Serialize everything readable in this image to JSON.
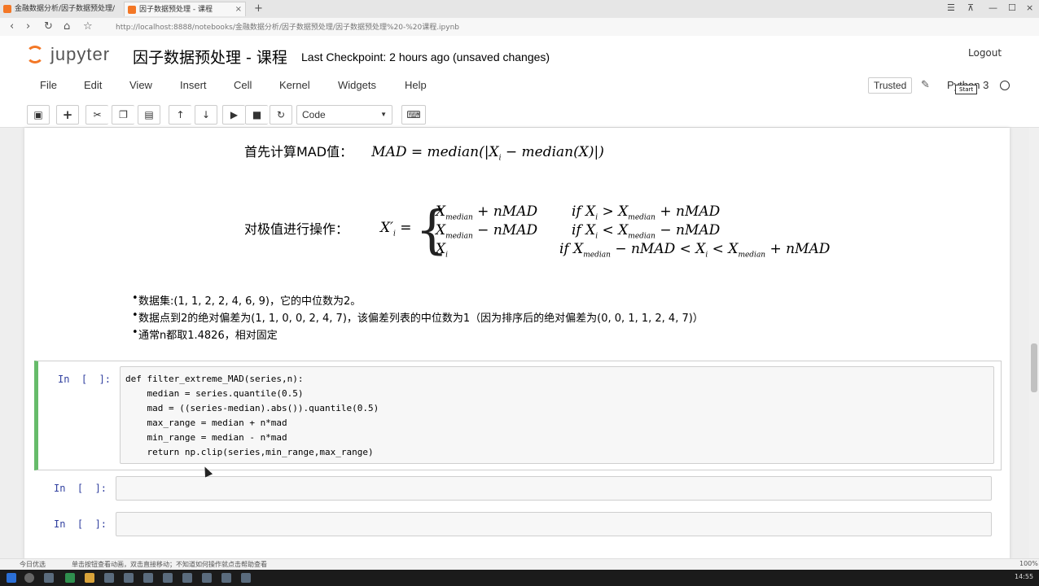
{
  "browser": {
    "tabs": [
      {
        "label": "金融数据分析/因子数据预处理/"
      },
      {
        "label": "因子数据预处理 - 课程"
      }
    ],
    "new_tab": "+",
    "url": "http://localhost:8888/notebooks/金融数据分析/因子数据预处理/因子数据预处理%20-%20课程.ipynb"
  },
  "jupyter": {
    "logo_text": "jupyter",
    "notebook_title": "因子数据预处理 - 课程",
    "checkpoint": "Last Checkpoint: 2 hours ago (unsaved changes)",
    "logout": "Logout"
  },
  "menu": [
    "File",
    "Edit",
    "View",
    "Insert",
    "Cell",
    "Kernel",
    "Widgets",
    "Help"
  ],
  "status": {
    "trusted": "Trusted",
    "kernel_name": "Python 3",
    "start_badge": "Start"
  },
  "toolbar": {
    "cell_type": "Code",
    "icons": [
      "save-icon",
      "add-cell-icon",
      "cut-icon",
      "copy-icon",
      "paste-icon",
      "move-up-icon",
      "move-down-icon",
      "run-icon",
      "stop-icon",
      "restart-icon",
      "keyboard-icon"
    ]
  },
  "markdown": {
    "mad_label": "首先计算MAD值：",
    "mad_formula": "MAD = median(|X",
    "mad_formula_sub": "i",
    "mad_formula_tail": " − median(X)|)",
    "extreme_label": "对极值进行操作：",
    "lhs": "X′",
    "lhs_sub": "i",
    "cases": [
      {
        "expr": "X",
        "expr_sub": "median",
        "expr_tail": " + nMAD",
        "cond_prefix": "if  X",
        "cond_sub": "i",
        "cond": " > X",
        "cond_sub2": "median",
        "cond_tail": " + nMAD"
      },
      {
        "expr": "X",
        "expr_sub": "median",
        "expr_tail": " − nMAD",
        "cond_prefix": "if  X",
        "cond_sub": "i",
        "cond": " < X",
        "cond_sub2": "median",
        "cond_tail": " − nMAD"
      },
      {
        "expr": "X",
        "expr_sub": "i",
        "expr_tail": "",
        "cond_prefix": "if  X",
        "cond_sub": "median",
        "cond": " − nMAD < X",
        "cond_sub2": "i",
        "cond_tail": " < X",
        "cond_sub3": "median",
        "cond_tail2": " + nMAD"
      }
    ],
    "bullets": [
      "数据集:(1, 1, 2, 2, 4, 6, 9)，它的中位数为2。",
      "数据点到2的绝对偏差为(1, 1, 0, 0, 2, 4, 7)，该偏差列表的中位数为1（因为排序后的绝对偏差为(0, 0, 1, 1, 2, 4, 7)）",
      "通常n都取1.4826，相对固定"
    ]
  },
  "cells": [
    {
      "prompt": "In  [  ]:",
      "code": [
        "def filter_extreme_MAD(series,n):",
        "    median = series.quantile(0.5)",
        "    mad = ((series-median).abs()).quantile(0.5)",
        "    max_range = median + n*mad",
        "    min_range = median - n*mad",
        "    return np.clip(series,min_range,max_range)"
      ]
    },
    {
      "prompt": "In  [  ]:",
      "code": []
    },
    {
      "prompt": "In  [  ]:",
      "code": []
    }
  ],
  "statusbar": {
    "left": "今日优选",
    "message": "单击按钮查看动画，双击直接移动；不知道如何操作就点击帮助查看",
    "zoom": "100%"
  },
  "taskbar": {
    "clock": "14:55"
  }
}
